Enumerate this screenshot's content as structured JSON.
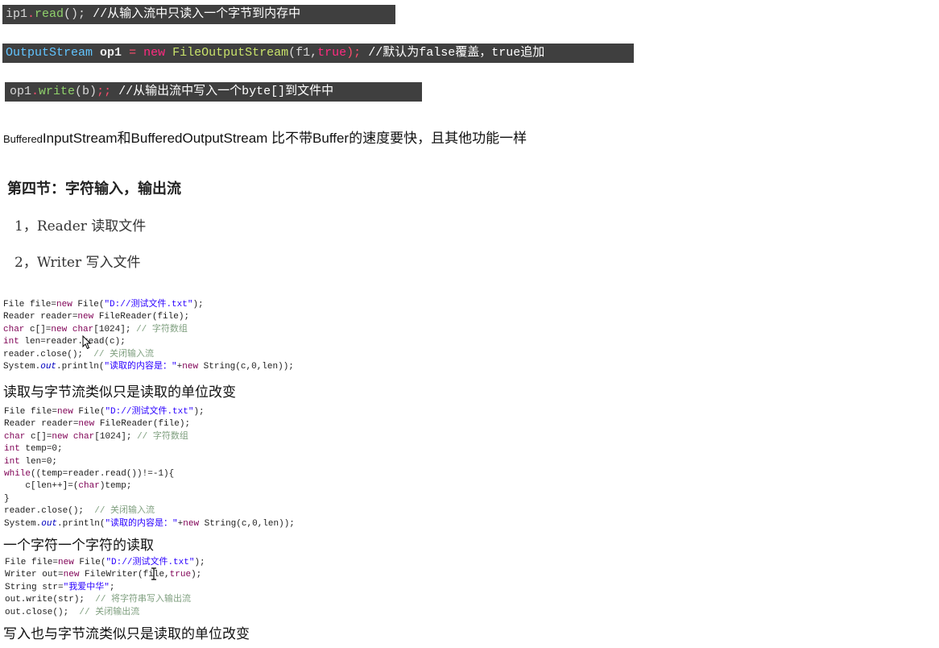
{
  "strip1": {
    "tokens": [
      "ip1",
      ".",
      "read",
      "();",
      "   //从输入流中只读入一个字节到内存中"
    ]
  },
  "strip2": {
    "tokens": [
      "OutputStream",
      " ",
      "op1",
      " = ",
      "new",
      " ",
      "FileOutputStream",
      "(f1,",
      "true",
      ");",
      "  //默认为false覆盖，true追加"
    ]
  },
  "strip3": {
    "tokens": [
      "op1",
      ".",
      "write",
      "(b)",
      ";;",
      "   //从输出流中写入一个byte[]到文件中"
    ]
  },
  "buffered_note": {
    "small": "Buffered",
    "rest": "InputStream和BufferedOutputStream 比不带Buffer的速度要快，且其他功能一样"
  },
  "section_title": "第四节：字符输入，输出流",
  "items": [
    "1，Reader 读取文件",
    "2，Writer 写入文件"
  ],
  "code1": [
    [
      [
        "File file=",
        ""
      ],
      [
        "new",
        "k"
      ],
      [
        " File(",
        ""
      ],
      [
        "\"D://测试文件.txt\"",
        "s"
      ],
      [
        ");",
        ""
      ]
    ],
    [
      [
        "Reader reader=",
        ""
      ],
      [
        "new",
        "k"
      ],
      [
        " FileReader(file);",
        ""
      ]
    ],
    [
      [
        "char",
        "k"
      ],
      [
        " c[]=",
        ""
      ],
      [
        "new",
        "k"
      ],
      [
        " ",
        ""
      ],
      [
        "char",
        "k"
      ],
      [
        "[1024]; ",
        ""
      ],
      [
        "// 字符数组",
        "c"
      ]
    ],
    [
      [
        "int",
        "k"
      ],
      [
        " len=reader.read(c);",
        ""
      ]
    ],
    [
      [
        "reader.close();  ",
        ""
      ],
      [
        "// 关闭输入流",
        "c"
      ]
    ],
    [
      [
        "System.",
        ""
      ],
      [
        "out",
        "i"
      ],
      [
        ".println(",
        ""
      ],
      [
        "\"读取的内容是：\"",
        "s"
      ],
      [
        "+",
        ""
      ],
      [
        "new",
        "k"
      ],
      [
        " String(c,0,len));",
        ""
      ]
    ]
  ],
  "caption1": "读取与字节流类似只是读取的单位改变",
  "code2": [
    [
      [
        "File file=",
        ""
      ],
      [
        "new",
        "k"
      ],
      [
        " File(",
        ""
      ],
      [
        "\"D://测试文件.txt\"",
        "s"
      ],
      [
        ");",
        ""
      ]
    ],
    [
      [
        "Reader reader=",
        ""
      ],
      [
        "new",
        "k"
      ],
      [
        " FileReader(file);",
        ""
      ]
    ],
    [
      [
        "char",
        "k"
      ],
      [
        " c[]=",
        ""
      ],
      [
        "new",
        "k"
      ],
      [
        " ",
        ""
      ],
      [
        "char",
        "k"
      ],
      [
        "[1024]; ",
        ""
      ],
      [
        "// 字符数组",
        "c"
      ]
    ],
    [
      [
        "int",
        "k"
      ],
      [
        " temp=0;",
        ""
      ]
    ],
    [
      [
        "int",
        "k"
      ],
      [
        " len=0;",
        ""
      ]
    ],
    [
      [
        "while",
        "k"
      ],
      [
        "((temp=reader.read())!=-1){",
        ""
      ]
    ],
    [
      [
        "    c[len++]=(",
        ""
      ],
      [
        "char",
        "k"
      ],
      [
        ")temp;",
        ""
      ]
    ],
    [
      [
        "}",
        ""
      ]
    ],
    [
      [
        "reader.close();  ",
        ""
      ],
      [
        "// 关闭输入流",
        "c"
      ]
    ],
    [
      [
        "System.",
        ""
      ],
      [
        "out",
        "i"
      ],
      [
        ".println(",
        ""
      ],
      [
        "\"读取的内容是：\"",
        "s"
      ],
      [
        "+",
        ""
      ],
      [
        "new",
        "k"
      ],
      [
        " String(c,0,len));",
        ""
      ]
    ]
  ],
  "caption2": "一个字符一个字符的读取",
  "code3": [
    [
      [
        "File file=",
        ""
      ],
      [
        "new",
        "k"
      ],
      [
        " File(",
        ""
      ],
      [
        "\"D://测试文件.txt\"",
        "s"
      ],
      [
        ");",
        ""
      ]
    ],
    [
      [
        "Writer out=",
        ""
      ],
      [
        "new",
        "k"
      ],
      [
        " FileWriter(file,",
        ""
      ],
      [
        "true",
        "k"
      ],
      [
        ");",
        ""
      ]
    ],
    [
      [
        "String str=",
        ""
      ],
      [
        "\"我爱中华\"",
        "s"
      ],
      [
        ";",
        ""
      ]
    ],
    [
      [
        "out.write(str);  ",
        ""
      ],
      [
        "// 将字符串写入输出流",
        "c"
      ]
    ],
    [
      [
        "out.close();  ",
        ""
      ],
      [
        "// 关闭输出流",
        "c"
      ]
    ]
  ],
  "caption3": "写入也与字节流类似只是读取的单位改变",
  "colors": {
    "strip_bg": "#3f3f3f",
    "keyword": "#7f0055",
    "string": "#2a00ff",
    "comment": "#7f9f7f"
  }
}
